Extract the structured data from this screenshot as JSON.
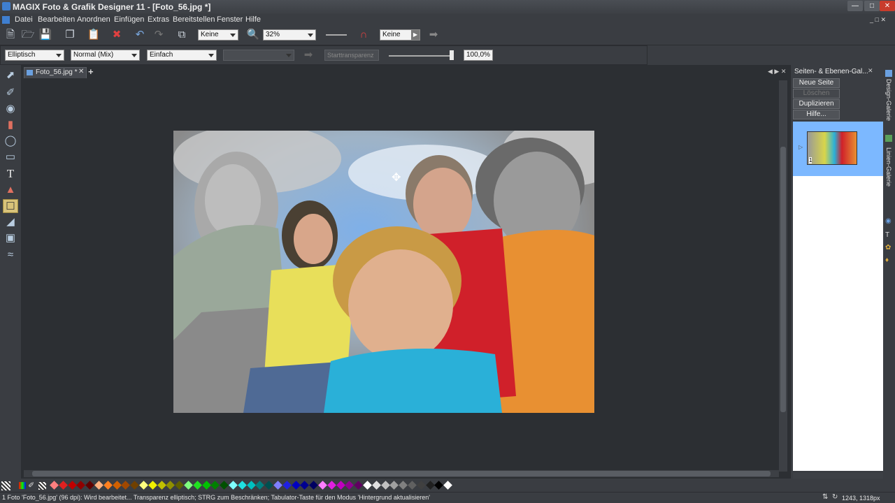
{
  "window": {
    "title": "MAGIX Foto & Grafik Designer 11 - [Foto_56.jpg *]"
  },
  "menu": {
    "items": [
      "Datei",
      "Bearbeiten",
      "Anordnen",
      "Einfügen",
      "Extras",
      "Bereitstellen",
      "Fenster",
      "Hilfe"
    ]
  },
  "toolbar1": {
    "feather_value": "Keine",
    "zoom_value": "32%",
    "transparency_type": "Keine"
  },
  "toolbar2": {
    "shape_value": "Elliptisch",
    "blend_value": "Normal (Mix)",
    "mode_value": "Einfach",
    "fill_value": "",
    "start_transparency_label": "Starttransparenz",
    "percent_value": "100,0%"
  },
  "document": {
    "tab_label": "Foto_56.jpg *"
  },
  "right_panel": {
    "title": "Seiten- & Ebenen-Gal...",
    "new_page": "Neue Seite",
    "delete": "Löschen",
    "duplicate": "Duplizieren",
    "help": "Hilfe...",
    "page_number": "1"
  },
  "side_tabs": {
    "design": "Design-Galerie",
    "lines": "Linien-Galerie"
  },
  "status": {
    "message": "1 Foto 'Foto_56.jpg' (96 dpi): Wird bearbeitet... Transparenz elliptisch; STRG zum Beschränken; Tabulator-Taste für den Modus 'Hintergrund aktualisieren'",
    "coords": "1243, 1318px"
  },
  "colors": {
    "accent": "#7cb8ff",
    "active_tool": "#d9c37a"
  },
  "palette": [
    "#ff7f7f",
    "#e02020",
    "#c00000",
    "#900000",
    "#600000",
    "#ffb07f",
    "#ff8020",
    "#d06000",
    "#a04800",
    "#704000",
    "#ffff7f",
    "#f0f000",
    "#c0c000",
    "#909000",
    "#606000",
    "#7fff7f",
    "#20e020",
    "#00c000",
    "#008000",
    "#005000",
    "#7fffff",
    "#20e0e0",
    "#00c0c0",
    "#008080",
    "#005050",
    "#7f7fff",
    "#2020e0",
    "#0000c0",
    "#000090",
    "#000060",
    "#ff7fff",
    "#e020e0",
    "#c000c0",
    "#900090",
    "#600060",
    "#ffffff",
    "#e0e0e0",
    "#c0c0c0",
    "#a0a0a0",
    "#808080",
    "#606060",
    "#404040",
    "#202020",
    "#000000",
    "#ffffff"
  ]
}
